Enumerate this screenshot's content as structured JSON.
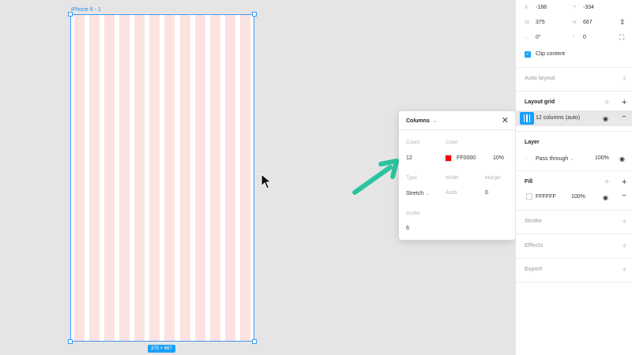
{
  "canvas": {
    "frame_label": "iPhone 8 - 1",
    "size_badge": "375 × 667",
    "grid_color": "#fde2e2",
    "column_count": 12
  },
  "popup": {
    "title": "Columns",
    "caret": "⌄",
    "close_icon": "close-icon",
    "count_label": "Count",
    "count_value": "12",
    "color_label": "Color",
    "color_hex": "FF0000",
    "color_swatch": "#ff0000",
    "opacity": "10%",
    "type_label": "Type",
    "type_value": "Stretch",
    "width_label": "Width",
    "width_value": "Auto",
    "margin_label": "Margin",
    "margin_value": "0",
    "gutter_label": "Gutter",
    "gutter_value": "6"
  },
  "panel": {
    "x_label": "X",
    "x_value": "-188",
    "y_label": "Y",
    "y_value": "-334",
    "w_label": "W",
    "w_value": "375",
    "h_label": "H",
    "h_value": "667",
    "rotation_value": "0°",
    "radius_value": "0",
    "clip_content_label": "Clip content",
    "auto_layout_title": "Auto layout",
    "layout_grid_title": "Layout grid",
    "grid_item_label": "12 columns (auto)",
    "layer_title": "Layer",
    "blend_mode": "Pass through",
    "layer_opacity": "100%",
    "fill_title": "Fill",
    "fill_hex": "FFFFFF",
    "fill_opacity": "100%",
    "stroke_title": "Stroke",
    "effects_title": "Effects",
    "export_title": "Export"
  },
  "colors": {
    "accent": "#18a0fb",
    "selection": "#3b9cf5",
    "arrow": "#2bc49f"
  }
}
